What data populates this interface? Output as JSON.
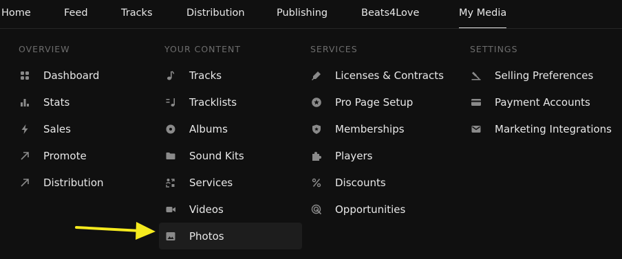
{
  "topnav": {
    "items": [
      "Home",
      "Feed",
      "Tracks",
      "Distribution",
      "Publishing",
      "Beats4Love",
      "My Media"
    ]
  },
  "columns": [
    {
      "header": "OVERVIEW",
      "items": [
        {
          "label": "Dashboard",
          "icon": "grid-icon"
        },
        {
          "label": "Stats",
          "icon": "bar-chart-icon"
        },
        {
          "label": "Sales",
          "icon": "bolt-icon"
        },
        {
          "label": "Promote",
          "icon": "arrow-up-right-icon"
        },
        {
          "label": "Distribution",
          "icon": "arrow-up-right-icon"
        }
      ]
    },
    {
      "header": "YOUR CONTENT",
      "items": [
        {
          "label": "Tracks",
          "icon": "music-note-icon"
        },
        {
          "label": "Tracklists",
          "icon": "playlist-icon"
        },
        {
          "label": "Albums",
          "icon": "disc-icon"
        },
        {
          "label": "Sound Kits",
          "icon": "folder-icon"
        },
        {
          "label": "Services",
          "icon": "services-icon"
        },
        {
          "label": "Videos",
          "icon": "video-camera-icon"
        },
        {
          "label": "Photos",
          "icon": "image-icon"
        }
      ]
    },
    {
      "header": "SERVICES",
      "items": [
        {
          "label": "Licenses & Contracts",
          "icon": "pen-icon"
        },
        {
          "label": "Pro Page Setup",
          "icon": "star-badge-icon"
        },
        {
          "label": "Memberships",
          "icon": "shield-icon"
        },
        {
          "label": "Players",
          "icon": "puzzle-icon"
        },
        {
          "label": "Discounts",
          "icon": "percent-icon"
        },
        {
          "label": "Opportunities",
          "icon": "target-icon"
        }
      ]
    },
    {
      "header": "SETTINGS",
      "items": [
        {
          "label": "Selling Preferences",
          "icon": "gavel-icon"
        },
        {
          "label": "Payment Accounts",
          "icon": "credit-card-icon"
        },
        {
          "label": "Marketing Integrations",
          "icon": "envelope-icon"
        }
      ]
    }
  ],
  "annotation": {
    "arrow_color": "#f5ea1e",
    "points_to": "Photos"
  },
  "colors": {
    "background": "#101010",
    "text": "#e8e8e8",
    "header": "#6d6d6d",
    "icon": "#8a8a8a",
    "highlight": "#1d1d1d"
  }
}
